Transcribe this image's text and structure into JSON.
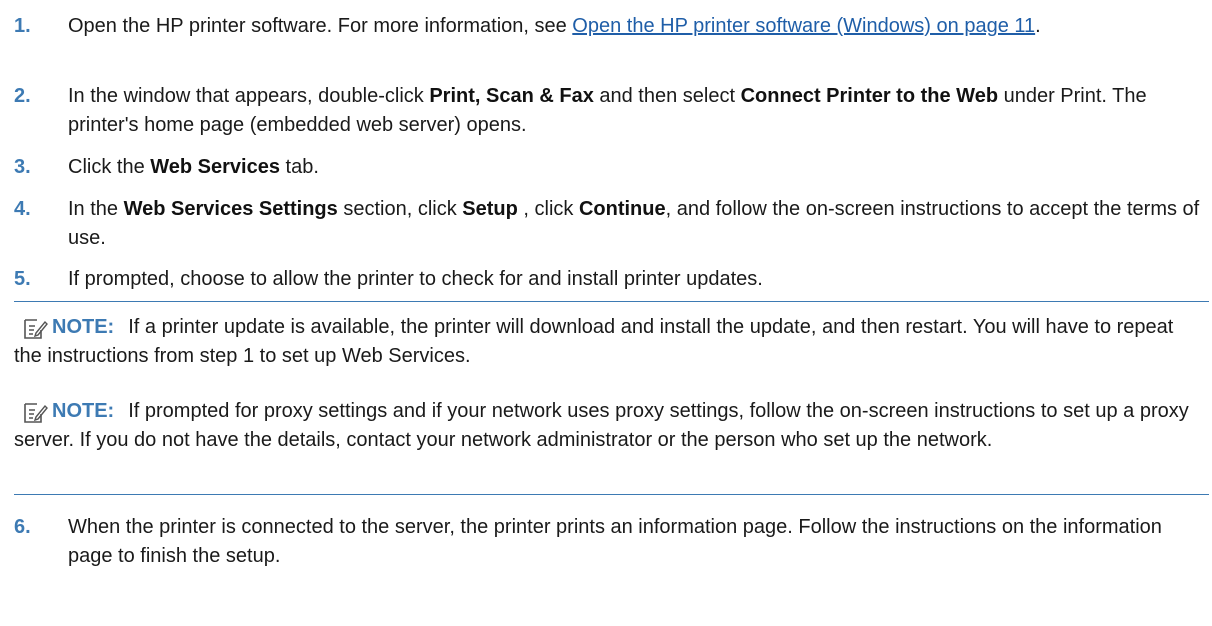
{
  "steps": [
    {
      "n": "1.",
      "a": "Open the HP printer software. For more information, see ",
      "link": "Open the HP printer software (Windows) on page 11",
      "b": "."
    },
    {
      "n": "2.",
      "a": "In the window that appears, double-click ",
      "bold1": "Print, Scan & Fax",
      "mid": " and then select ",
      "bold2": "Connect Printer to the Web",
      "b": " under Print. The printer's home page (embedded web server) opens."
    },
    {
      "n": "3.",
      "a": "Click the ",
      "bold1": "Web Services",
      "b": " tab."
    },
    {
      "n": "4.",
      "a": "In the ",
      "bold1": "Web Services Settings",
      "mid1": " section, click ",
      "bold2": "Setup",
      "mid2": " , click ",
      "bold3": "Continue",
      "b": ", and follow the on-screen instructions to accept the terms of use."
    },
    {
      "n": "5.",
      "a": "If prompted, choose to allow the printer to check for and install printer updates."
    },
    {
      "n": "6.",
      "a": "When the printer is connected to the server, the printer prints an information page. Follow the instructions on the information page to finish the setup."
    }
  ],
  "notes": [
    {
      "label": "NOTE:",
      "text": "If a printer update is available, the printer will download and install the update, and then restart. You will have to repeat the instructions from step 1 to set up Web Services."
    },
    {
      "label": "NOTE:",
      "text": "If prompted for proxy settings and if your network uses proxy settings, follow the on-screen instructions to set up a proxy server. If you do not have the details, contact your network administrator or the person who set up the network."
    }
  ],
  "colors": {
    "accent": "#3d7ab3",
    "link": "#1f5ea8",
    "text": "#1a1a1a"
  },
  "icons": {
    "note": "note-pencil-icon"
  }
}
